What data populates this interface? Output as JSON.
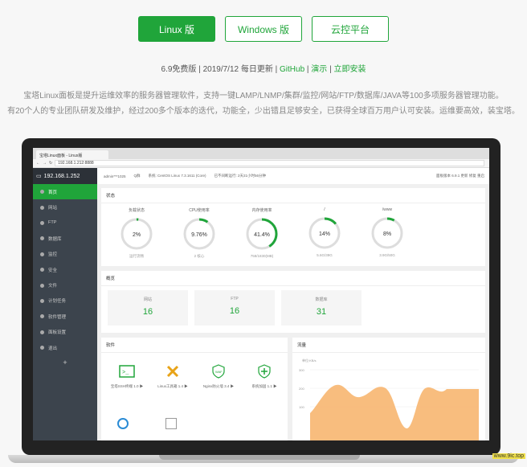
{
  "buttons": [
    {
      "label": "Linux 版",
      "active": true
    },
    {
      "label": "Windows 版",
      "active": false
    },
    {
      "label": "云控平台",
      "active": false
    }
  ],
  "meta": {
    "version": "6.9免费版",
    "sep1": " | ",
    "updated": "2019/7/12 每日更新",
    "sep2": " | ",
    "github": "GitHub",
    "sep3": " | ",
    "demo": "演示",
    "sep4": " | ",
    "install": "立即安装"
  },
  "description": {
    "line1": "宝塔Linux面板是提升运维效率的服务器管理软件，支持一键LAMP/LNMP/集群/监控/网站/FTP/数据库/JAVA等100多项服务器管理功能。",
    "line2": "有20个人的专业团队研发及维护，经过200多个版本的迭代，功能全，少出错且足够安全，已获得全球百万用户认可安装。运维要高效，装宝塔。"
  },
  "browser": {
    "tab": "宝塔Linux面板 - Linux版",
    "url": "192.168.1.212:8888"
  },
  "sidebar": {
    "host": "192.168.1.252",
    "items": [
      {
        "label": "首页",
        "active": true
      },
      {
        "label": "网站",
        "active": false
      },
      {
        "label": "FTP",
        "active": false
      },
      {
        "label": "数据库",
        "active": false
      },
      {
        "label": "监控",
        "active": false
      },
      {
        "label": "安全",
        "active": false
      },
      {
        "label": "文件",
        "active": false
      },
      {
        "label": "计划任务",
        "active": false
      },
      {
        "label": "软件管理",
        "active": false
      },
      {
        "label": "面板设置",
        "active": false
      },
      {
        "label": "退出",
        "active": false
      }
    ],
    "add": "+"
  },
  "infobar": {
    "user": "admin***1025",
    "qq": "Q群",
    "os": "系统: CentOS Linux 7.3.1611 (Core)",
    "uptime": "已不间断运行: 2天21小时56分钟",
    "right": "面板版本 6.9.1  更新  修复  重启"
  },
  "status": {
    "title": "状态",
    "gauges": [
      {
        "label": "负载状态",
        "value": "2%",
        "sub": "运行流畅",
        "percent": 2
      },
      {
        "label": "CPU使用率",
        "value": "9.76%",
        "sub": "2 核心",
        "percent": 9.76
      },
      {
        "label": "内存使用率",
        "value": "41.4%",
        "sub": "758/1830(MB)",
        "percent": 41.4
      },
      {
        "label": "/",
        "value": "14%",
        "sub": "5.6G/39G",
        "percent": 14
      },
      {
        "label": "/www",
        "value": "8%",
        "sub": "3.9G/50G",
        "percent": 8
      }
    ]
  },
  "overview": {
    "title": "概览",
    "stats": [
      {
        "label": "网站",
        "value": "16"
      },
      {
        "label": "FTP",
        "value": "16"
      },
      {
        "label": "数据库",
        "value": "31"
      }
    ]
  },
  "software": {
    "title": "软件",
    "items": [
      {
        "label": "宝塔SSH终端 1.0 ▶",
        "icon": "terminal-icon"
      },
      {
        "label": "Linux工具箱 1.4 ▶",
        "icon": "tools-icon"
      },
      {
        "label": "Nginx防火墙 3.4 ▶",
        "icon": "waf-icon"
      },
      {
        "label": "系统加固 1.1 ▶",
        "icon": "shield-plus-icon"
      }
    ]
  },
  "traffic": {
    "title": "流量",
    "unit": "单位:KB/s",
    "ticks": [
      "300",
      "200",
      "100"
    ],
    "color": "#f7b267"
  },
  "watermark": "www.9ic.top",
  "colors": {
    "accent": "#20a53a",
    "sidebar": "#3c444d"
  }
}
